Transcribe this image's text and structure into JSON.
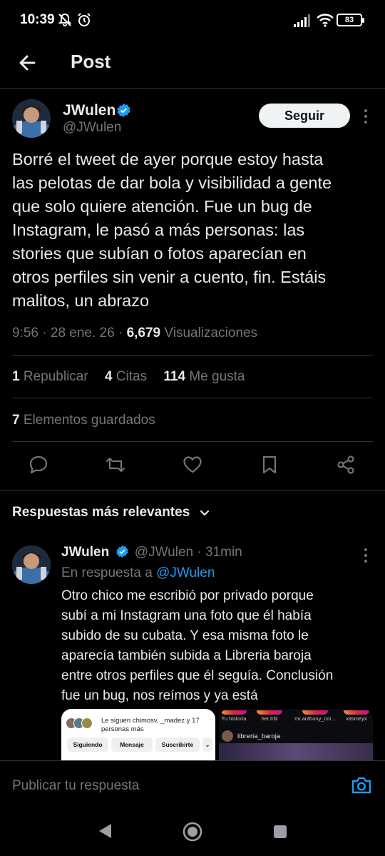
{
  "status_bar": {
    "time": "10:39",
    "battery": "83"
  },
  "header": {
    "title": "Post",
    "back_icon": "arrow-left-icon"
  },
  "tweet": {
    "author_name": "JWulen",
    "handle": "@JWulen",
    "follow_label": "Seguir",
    "text": "Borré el tweet de ayer porque estoy hasta\nlas pelotas de dar bola y visibilidad a gente\nque solo quiere atención. Fue un bug de\nInstagram, le pasó a más personas: las\nstories que subían o fotos aparecían en\notros perfiles sin venir a cuento, fin. Estáis\nmalitos, un abrazo",
    "time": "9:56",
    "date": "28 ene. 26",
    "views_count": "6,679",
    "views_label": "Visualizaciones",
    "reposts_count": "1",
    "reposts_label": "Republicar",
    "quotes_count": "4",
    "quotes_label": "Citas",
    "likes_count": "114",
    "likes_label": "Me gusta",
    "bookmarks_count": "7",
    "bookmarks_label": "Elementos guardados"
  },
  "colors": {
    "accent": "#1d9bf0",
    "background": "#000000",
    "muted": "#71767b",
    "divider": "#2f3336"
  },
  "replies_sort": {
    "label": "Respuestas más relevantes"
  },
  "reply": {
    "author_name": "JWulen",
    "handle": "@JWulen",
    "age": "31min",
    "reply_to_prefix": "En respuesta a",
    "reply_to_handle": "@JWulen",
    "text": "Otro chico me escribió por privado porque\nsubí a mi Instagram una foto que él había\nsubido de su cubata. Y esa misma foto le\naparecía también subida a Libreria baroja\nentre otros perfiles que él seguía. Conclusión\nfue un bug, nos reímos y ya está",
    "media_left": {
      "followed_by": "Le siguen chimosv, _madez y 17 personas más",
      "btn_following": "Siguiendo",
      "btn_message": "Mensaje",
      "btn_subscribe": "Suscribirte"
    },
    "media_right": {
      "stories": [
        "Tu historia",
        "her.trbl",
        "mr.anthony_cor...",
        "xitsmeyx"
      ],
      "post_account": "libreria_baroja"
    }
  },
  "composer": {
    "placeholder": "Publicar tu respuesta"
  }
}
